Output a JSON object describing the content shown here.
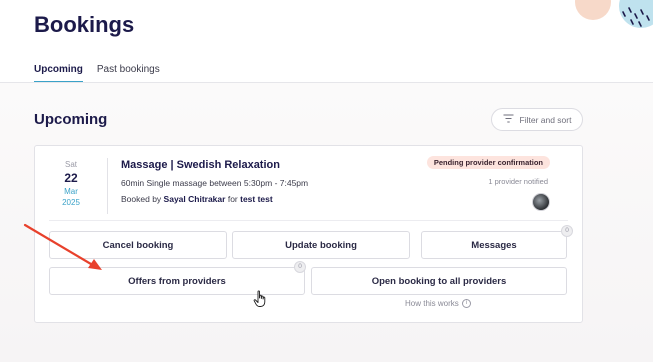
{
  "page": {
    "title": "Bookings"
  },
  "tabs": [
    {
      "label": "Upcoming",
      "active": true
    },
    {
      "label": "Past bookings",
      "active": false
    }
  ],
  "section": {
    "title": "Upcoming",
    "filter_label": "Filter and sort"
  },
  "booking": {
    "date": {
      "weekday": "Sat",
      "day": "22",
      "month": "Mar",
      "year": "2025"
    },
    "service_title": "Massage | Swedish Relaxation",
    "description": "60min Single massage between 5:30pm - 7:45pm",
    "booked_by_prefix": "Booked by",
    "booked_by_name": "Sayal Chitrakar",
    "for_word": "for",
    "for_name": "test test",
    "status": "Pending provider confirmation",
    "providers_notified": "1 provider notified"
  },
  "actions": {
    "cancel": "Cancel booking",
    "update": "Update booking",
    "messages": "Messages",
    "messages_count": "0",
    "offers": "Offers from providers",
    "offers_count": "0",
    "open_all": "Open booking to all providers",
    "how_works": "How this works"
  },
  "icons": {
    "filter": "filter-icon",
    "info": "info-icon",
    "avatar": "avatar",
    "arrow": "red-arrow-annotation",
    "cursor": "hand-cursor-icon"
  },
  "colors": {
    "accent": "#3aa2c8",
    "title": "#1c1a4a",
    "badge_bg": "#fde4de",
    "arrow": "#e8412c"
  }
}
